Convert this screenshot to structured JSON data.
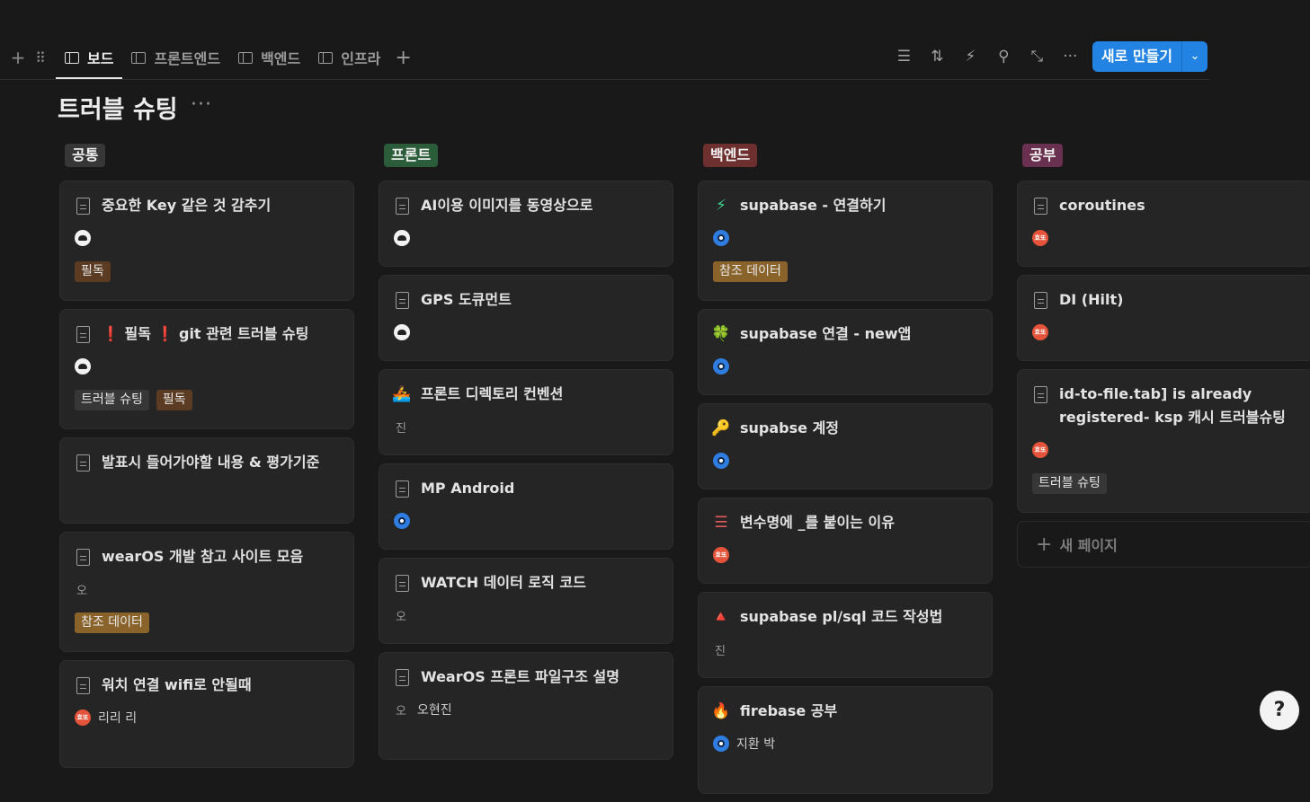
{
  "toolbar": {
    "add_icon": "plus-icon",
    "drag_icon": "drag-handle-icon",
    "tabs": [
      {
        "label": "보드",
        "icon": "board-view-icon",
        "active": true
      },
      {
        "label": "프론트엔드",
        "icon": "table-view-icon",
        "active": false
      },
      {
        "label": "백엔드",
        "icon": "table-view-icon",
        "active": false
      },
      {
        "label": "인프라",
        "icon": "table-view-icon",
        "active": false
      }
    ],
    "add_view": "+",
    "tools": [
      "filter-icon",
      "sort-icon",
      "automation-icon",
      "search-icon",
      "expand-icon",
      "more-icon"
    ],
    "new_button": "새로 만들기",
    "new_dropdown": "chevron-down-icon",
    "accent": "#2383e2"
  },
  "page": {
    "title": "트러블 슈팅",
    "more": "···"
  },
  "columns": [
    {
      "name": "공통",
      "color": "#373737",
      "cards": [
        {
          "title": "중요한 Key 같은 것 감추기",
          "person": "",
          "avatar": "white",
          "tags": [
            "필독"
          ]
        },
        {
          "title": "❗ 필독 ❗ git 관련 트러블 슈팅",
          "person": "",
          "avatar": "white",
          "tags": [
            "트러블 슈팅",
            "필독"
          ]
        },
        {
          "title": "발표시 들어가야할 내용 & 평가기준",
          "person": "",
          "avatar": "none",
          "tags": []
        },
        {
          "title": "wearOS 개발 참고 사이트 모음",
          "person": "",
          "initial": "오",
          "tags": [
            "참조 데이터"
          ]
        },
        {
          "title": "워치 연결 wifi로 안될때",
          "person": "리리 리",
          "avatar": "red",
          "avatar_text": "효또",
          "tags": []
        }
      ]
    },
    {
      "name": "프론트",
      "color": "#2b5d3a",
      "cards": [
        {
          "title": "AI이용 이미지를 동영상으로",
          "avatar": "white"
        },
        {
          "title": "GPS 도큐먼트",
          "avatar": "white"
        },
        {
          "title": "프론트 디렉토리 컨벤션",
          "icon": "🚣",
          "initial": "진"
        },
        {
          "title": "MP Android",
          "avatar": "blue"
        },
        {
          "title": "WATCH 데이터 로직 코드",
          "initial": "오"
        },
        {
          "title": "WearOS 프론트 파일구조 설명",
          "initial": "오",
          "person": "오현진"
        }
      ]
    },
    {
      "name": "백엔드",
      "color": "#6e2f2f",
      "cards": [
        {
          "title": "supabase - 연결하기",
          "icon": "⚡",
          "avatar": "blue",
          "tags": [
            "참조 데이터"
          ]
        },
        {
          "title": "supabase 연결 - new앱",
          "icon": "🍀",
          "avatar": "blue"
        },
        {
          "title": "supabse 계정",
          "icon": "🔑",
          "avatar": "blue"
        },
        {
          "title": "변수명에 _를 붙이는 이유",
          "icon": "☰",
          "avatar": "red",
          "avatar_text": "효또"
        },
        {
          "title": "supabase pl/sql 코드 작성법",
          "icon": "🔺",
          "initial": "진"
        },
        {
          "title": "firebase 공부",
          "icon": "🔥",
          "avatar": "blue",
          "person": "지환 박"
        }
      ]
    },
    {
      "name": "공부",
      "color": "#69304f",
      "cards": [
        {
          "title": "coroutines",
          "avatar": "red",
          "avatar_text": "효또"
        },
        {
          "title": "DI (Hilt)",
          "avatar": "red",
          "avatar_text": "효또"
        },
        {
          "title": "id-to-file.tab] is already registered- ksp 캐시 트러블슈팅",
          "avatar": "red",
          "avatar_text": "효또",
          "tags": [
            "트러블 슈팅"
          ]
        }
      ],
      "new_page": "새 페이지"
    }
  ],
  "help": "?"
}
